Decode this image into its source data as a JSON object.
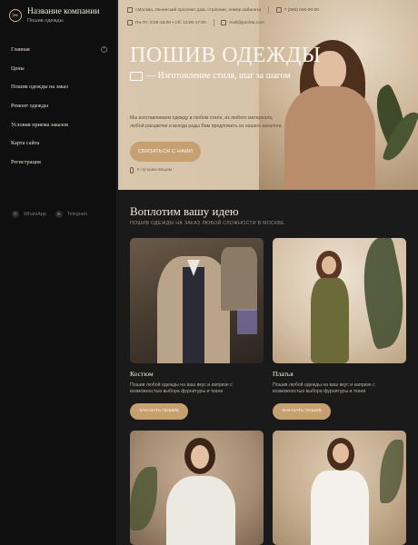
{
  "brand": {
    "title": "Название компании",
    "subtitle": "Пошив одежды",
    "logo_icon": "needle-logo-icon"
  },
  "sidebar": {
    "items": [
      {
        "label": "Главная",
        "has_expand": true
      },
      {
        "label": "Цены"
      },
      {
        "label": "Пошив одежды на заказ"
      },
      {
        "label": "Ремонт одежды"
      },
      {
        "label": "Условия приема заказов"
      },
      {
        "label": "Карта сайта"
      },
      {
        "label": "Регистрация"
      }
    ],
    "socials": [
      {
        "label": "WhatsApp",
        "icon": "whatsapp-icon"
      },
      {
        "label": "Telegram",
        "icon": "telegram-icon"
      }
    ]
  },
  "topbar": {
    "address": "г.Москва, Ленинский проспект дом, строение, номер кабинета",
    "hours": "Пн-Пт: 9:00-18:00  •  Сб: 10:00-17:00",
    "phone": "7 (000) 000-00-00",
    "email": "mail@pochta.com"
  },
  "hero": {
    "title": "ПОШИВ ОДЕЖДЫ",
    "subtitle": "— Изготовление стиля, шаг за шагом",
    "description": "Мы изготавливаем одежду в любом стиле, из любого материала, любой расцветки и всегда рады Вам предложить из нашего каталога",
    "button": "СВЯЗАТЬСЯ С НАМИ",
    "scroll_hint": "К лучшим вещам"
  },
  "section": {
    "title": "Воплотим вашу идею",
    "subtitle": "ПОШИВ ОДЕЖДЫ НА ЗАКАЗ ЛЮБОЙ СЛОЖНОСТИ В МОСКВЕ"
  },
  "cards": [
    {
      "title": "Костюм",
      "description": "Пошив любой одежды на ваш вкус и капризе с возможностью выбора фурнитуры и ткани",
      "button": "ЗАКАЗАТЬ ПОШИВ"
    },
    {
      "title": "Платья",
      "description": "Пошив любой одежды на ваш вкус и капризе с возможностью выбора фурнитуры и ткани",
      "button": "ЗАКАЗАТЬ ПОШИВ"
    }
  ],
  "colors": {
    "accent": "#c7a072",
    "sidebar_bg": "#0f0f10",
    "content_bg": "#1a1a1a"
  }
}
